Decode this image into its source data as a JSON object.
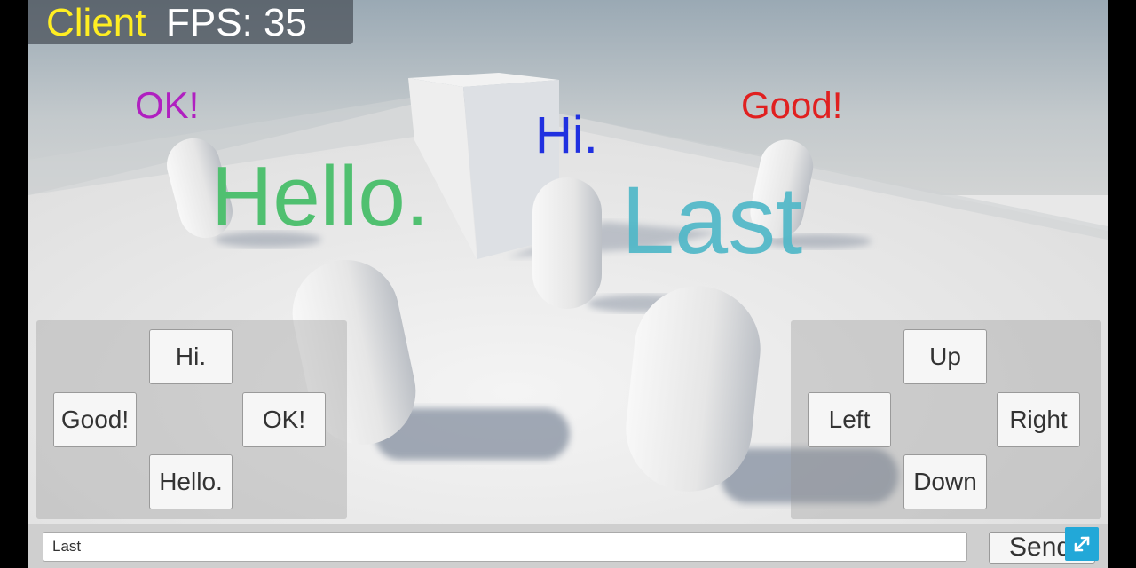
{
  "hud": {
    "role_label": "Client",
    "fps_label": "FPS: 35"
  },
  "floating_messages": [
    {
      "text": "OK!",
      "color": "#b020c0"
    },
    {
      "text": "Good!",
      "color": "#e02020"
    },
    {
      "text": "Hi.",
      "color": "#2030e0"
    },
    {
      "text": "Hello.",
      "color": "#50c070"
    },
    {
      "text": "Last",
      "color": "#50b8c8"
    }
  ],
  "message_panel": {
    "buttons": {
      "hi": "Hi.",
      "good": "Good!",
      "ok": "OK!",
      "hello": "Hello."
    }
  },
  "move_panel": {
    "buttons": {
      "up": "Up",
      "left": "Left",
      "right": "Right",
      "down": "Down"
    }
  },
  "chat": {
    "input_value": "Last",
    "send_label": "Send"
  },
  "icons": {
    "fullscreen": "expand-icon"
  },
  "colors": {
    "fullscreen_button": "#22a8d8",
    "client_label": "#ffee22"
  }
}
